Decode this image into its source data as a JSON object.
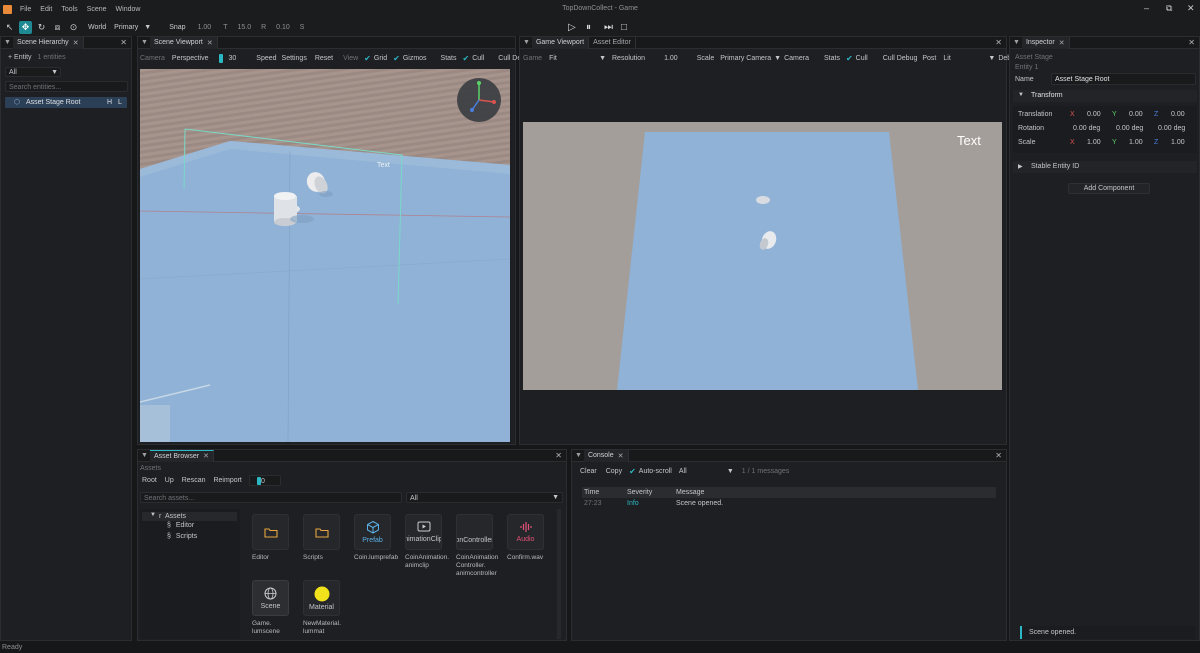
{
  "app": {
    "title": "TopDownCollect - Game",
    "menus": [
      "File",
      "Edit",
      "Tools",
      "Scene",
      "Window"
    ],
    "status": "Ready"
  },
  "toolbar": {
    "space": "World",
    "pivot": "Primary",
    "snap_label": "Snap",
    "snap_value": "1.00",
    "t_label": "T",
    "t_value": "15.0",
    "r_label": "R",
    "r_value": "0.10",
    "s_label": "S"
  },
  "hierarchy": {
    "tab": "Scene Hierarchy",
    "add_entity": "+ Entity",
    "count": "1 entities",
    "filter": "All",
    "search_placeholder": "Search entities...",
    "items": [
      {
        "label": "Asset Stage Root",
        "h": "H",
        "l": "L"
      }
    ]
  },
  "scene_viewport": {
    "tab": "Scene Viewport",
    "camera_label": "Camera",
    "projection": "Perspective",
    "fov": "30",
    "speed": "Speed",
    "settings": "Settings",
    "reset": "Reset",
    "view_label": "View",
    "grid": "Grid",
    "gizmos": "Gizmos",
    "stats": "Stats",
    "cull": "Cull",
    "cull_debug": "Cull De",
    "scene_text": "Text"
  },
  "game_viewport": {
    "tabs": [
      "Game Viewport",
      "Asset Editor"
    ],
    "game_label": "Game",
    "fit": "Fit",
    "resolution_label": "Resolution",
    "resolution_value": "1.00",
    "scale_label": "Scale",
    "camera_select": "Primary Camera",
    "camera_label": "Camera",
    "stats": "Stats",
    "cull": "Cull",
    "cull_debug": "Cull Debug",
    "post": "Post",
    "lit": "Lit",
    "debug": "Debug",
    "debug_trunc": "De",
    "text": "Text"
  },
  "inspector": {
    "tab": "Inspector",
    "entity_type": "Asset Stage",
    "entity_id": "Entity 1",
    "name_label": "Name",
    "name_value": "Asset Stage Root",
    "transform_label": "Transform",
    "rows": [
      {
        "label": "Translation",
        "x": "0.00",
        "y": "0.00",
        "z": "0.00"
      },
      {
        "label": "Rotation",
        "x": "0.00 deg",
        "y": "0.00 deg",
        "z": "0.00 deg"
      },
      {
        "label": "Scale",
        "x": "1.00",
        "y": "1.00",
        "z": "1.00"
      }
    ],
    "axis_x": "X",
    "axis_y": "Y",
    "axis_z": "Z",
    "stable_id": "Stable Entity ID",
    "add_component": "Add Component",
    "toast": "Scene opened."
  },
  "assets": {
    "tab": "Asset Browser",
    "title": "Assets",
    "buttons": [
      "Root",
      "Up",
      "Rescan",
      "Reimport"
    ],
    "slider_value": "0",
    "search_placeholder": "Search assets...",
    "filter": "All",
    "tree": {
      "root": "Assets",
      "root_prefix": "r",
      "children": [
        {
          "prefix": "§",
          "label": "Editor"
        },
        {
          "prefix": "§",
          "label": "Scripts"
        }
      ]
    },
    "tiles": [
      {
        "badge": "",
        "name": "Editor",
        "icon": "folder-icon"
      },
      {
        "badge": "",
        "name": "Scripts",
        "icon": "folder-icon"
      },
      {
        "badge": "Prefab",
        "name": "Coin.lumprefab",
        "icon": "cube-icon"
      },
      {
        "badge": "nimationClip",
        "name": "CoinAnimation.\nanimclip",
        "icon": "play-icon"
      },
      {
        "badge": "onController",
        "name": "CoinAnimation\nController.\nanimcontroller",
        "icon": "none"
      },
      {
        "badge": "Audio",
        "name": "Confirm.wav",
        "icon": "waveform-icon"
      },
      {
        "badge": "Scene",
        "name": "Game.\nlumscene",
        "icon": "globe-icon"
      },
      {
        "badge": "Material",
        "name": "NewMaterial.\nlummat",
        "icon": "sphere-icon"
      }
    ]
  },
  "console": {
    "tab": "Console",
    "clear": "Clear",
    "copy": "Copy",
    "autoscroll": "Auto-scroll",
    "filter": "All",
    "count": "1 / 1 messages",
    "headers": [
      "Time",
      "Severity",
      "Message"
    ],
    "rows": [
      {
        "time": "27:23",
        "severity": "Info",
        "message": "Scene opened."
      }
    ]
  },
  "colors": {
    "accent": "#2bb7c4",
    "audio": "#e2507a",
    "material": "#f2e21b"
  }
}
